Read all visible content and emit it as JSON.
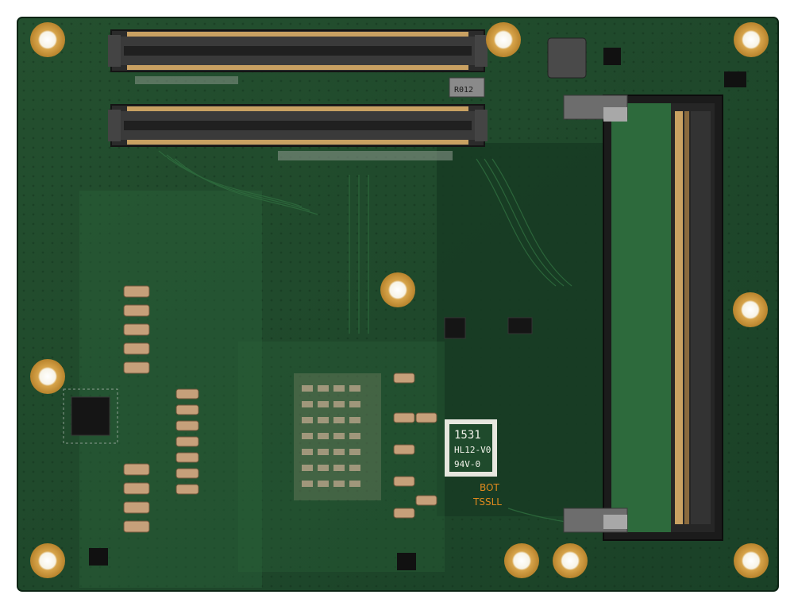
{
  "image": {
    "subject": "Computer-on-module PCB, bottom side, with two board-to-board connectors and a SO-DIMM memory slot",
    "palette": {
      "background": "#ffffff",
      "board": "#1f4a2c",
      "board_dark": "#163822",
      "board_light": "#2d6a3c",
      "gold": "#d7a44a",
      "copper": "#c9a162",
      "connector": "#2a2a2a",
      "silkscreen": "#f2f2ea",
      "orange_text": "#e08a1e"
    }
  },
  "board_labels": {
    "date_code": "1531",
    "ul_mark": "HL12-V0",
    "flammability": "94V-0",
    "side": "BOT",
    "maker": "TSSLL",
    "part_mark": "R012"
  }
}
